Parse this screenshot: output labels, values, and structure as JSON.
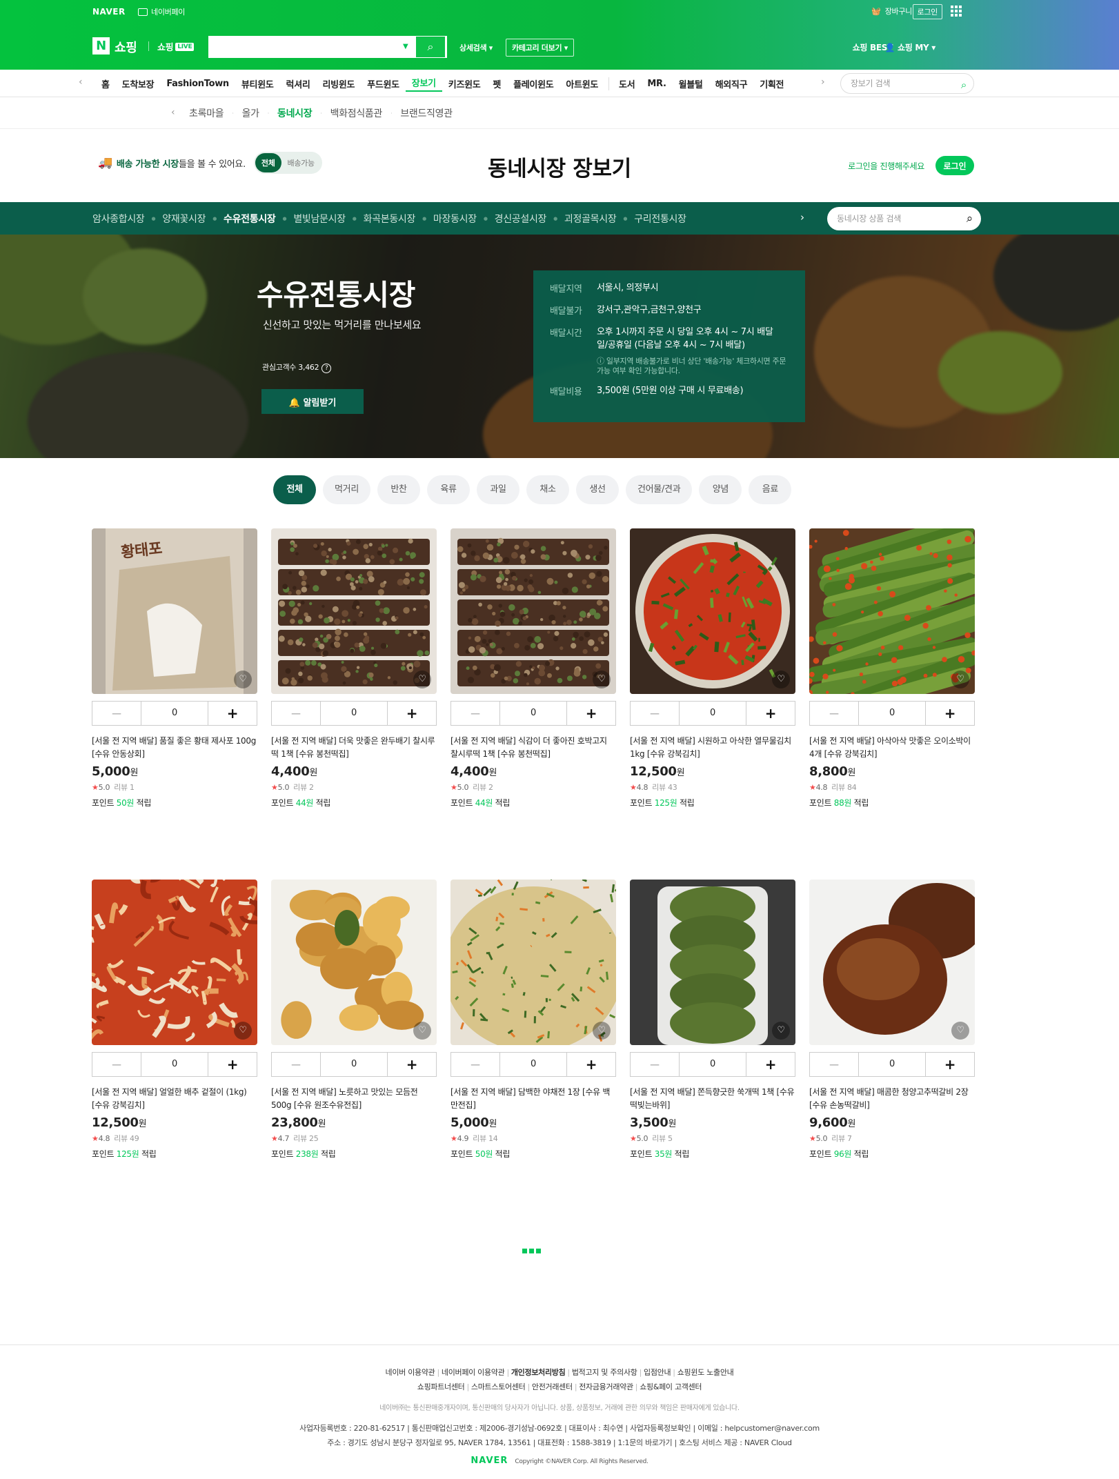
{
  "topbar": {
    "naver": "NAVER",
    "npay": "네이버페이",
    "cart": "장바구니",
    "login": "로그인",
    "shopping": "쇼핑",
    "shoplive": "쇼핑",
    "live": "LIVE",
    "adv_search": "상세검색",
    "cat_more": "카테고리 더보기",
    "best": "쇼핑 BEST",
    "my": "쇼핑 MY"
  },
  "nav": {
    "items": [
      "홈",
      "도착보장",
      "FashionTown",
      "뷰티윈도",
      "럭셔리",
      "리빙윈도",
      "푸드윈도",
      "장보기",
      "키즈윈도",
      "펫",
      "플레이윈도",
      "아트윈도",
      "도서",
      "MR.",
      "윌블털",
      "해외직구",
      "기획전"
    ],
    "active_index": 7,
    "search_placeholder": "장보기 검색"
  },
  "subnav": {
    "items": [
      "초록마을",
      "올가",
      "동네시장",
      "백화점식품관",
      "브랜드직영관"
    ],
    "active_index": 2
  },
  "market_header": {
    "avail_text_bold": "배송 가능한 시장",
    "avail_text": "들을 볼 수 있어요.",
    "toggle_all": "전체",
    "toggle_avail": "배송가능",
    "title": "동네시장 장보기",
    "login_msg": "로그인을 진행해주세요",
    "login_btn": "로그인"
  },
  "market_tabs": {
    "items": [
      "암사종합시장",
      "양재꽃시장",
      "수유전통시장",
      "별빛남문시장",
      "화곡본동시장",
      "마장동시장",
      "경신공설시장",
      "괴정골목시장",
      "구리전통시장"
    ],
    "active_index": 2,
    "search_placeholder": "동네시장 상품 검색"
  },
  "hero": {
    "name": "수유전통시장",
    "subtitle": "신선하고 맛있는 먹거리를 만나보세요",
    "fans": "관심고객수 3,462",
    "alert_btn": "알림받기",
    "info": [
      {
        "k": "배달지역",
        "v": "서울시, 의정부시"
      },
      {
        "k": "배달불가",
        "v": "강서구,관악구,금천구,양천구"
      },
      {
        "k": "배달시간",
        "v": "오후 1시까지 주문 시 당일 오후 4시 ~ 7시 배달\n일/공휴일 (다음날 오후 4시 ~ 7시 배달)"
      },
      {
        "k": "배달비용",
        "v": "3,500원 (5만원 이상 구매 시 무료배송)"
      }
    ],
    "note": "ⓘ 일부지역 배송불가로 비너 상단 '배송가능' 체크하시면 주문 가능 여부 확인 가능합니다."
  },
  "categories": {
    "items": [
      "전체",
      "먹거리",
      "반찬",
      "육류",
      "과일",
      "채소",
      "생선",
      "건어물/견과",
      "양념",
      "음료"
    ],
    "active_index": 0
  },
  "products": [
    {
      "name": "[서울 전 지역 배달] 품질 좋은 황태 제사포 100g [수유 안동상회]",
      "price": "5,000",
      "rating": "5.0",
      "reviews": "리뷰 1",
      "point": "50원",
      "qty": "0",
      "img": "pollack",
      "label": "황태포"
    },
    {
      "name": "[서울 전 지역 배달] 더욱 맛좋은 완두배기 찰시루떡 1책 [수유 봉천떡집]",
      "price": "4,400",
      "rating": "5.0",
      "reviews": "리뷰 2",
      "point": "44원",
      "qty": "0",
      "img": "ricecake"
    },
    {
      "name": "[서울 전 지역 배달] 식감이 더 좋아진 호박고지 찰시루떡 1책 [수유 봉천떡집]",
      "price": "4,400",
      "rating": "5.0",
      "reviews": "리뷰 2",
      "point": "44원",
      "qty": "0",
      "img": "ricecake2"
    },
    {
      "name": "[서울 전 지역 배달] 시원하고 아삭한 열무물김치 1kg [수유 강북김치]",
      "price": "12,500",
      "rating": "4.8",
      "reviews": "리뷰 43",
      "point": "125원",
      "qty": "0",
      "img": "yeolmu"
    },
    {
      "name": "[서울 전 지역 배달] 아삭아삭 맛좋은 오이소박이 4개 [수유 강북김치]",
      "price": "8,800",
      "rating": "4.8",
      "reviews": "리뷰 84",
      "point": "88원",
      "qty": "0",
      "img": "cucumber"
    },
    {
      "name": "[서울 전 지역 배달] 얼얼한 배추 겉절이 (1kg) [수유 강북김치]",
      "price": "12,500",
      "rating": "4.8",
      "reviews": "리뷰 49",
      "point": "125원",
      "qty": "0",
      "img": "kimchi"
    },
    {
      "name": "[서울 전 지역 배달] 노릇하고 맛있는 모듬전 500g [수유 원조수유전집]",
      "price": "23,800",
      "rating": "4.7",
      "reviews": "리뷰 25",
      "point": "238원",
      "qty": "0",
      "img": "jeon"
    },
    {
      "name": "[서울 전 지역 배달] 담백한 야채전 1장 [수유 백만전집]",
      "price": "5,000",
      "rating": "4.9",
      "reviews": "리뷰 14",
      "point": "50원",
      "qty": "0",
      "img": "pajeon"
    },
    {
      "name": "[서울 전 지역 배달] 쫀득향긋한 쑥개떡 1책 [수유 떡빚는바위]",
      "price": "3,500",
      "rating": "5.0",
      "reviews": "리뷰 5",
      "point": "35원",
      "qty": "0",
      "img": "ssuk"
    },
    {
      "name": "[서울 전 지역 배달] 매콤한 청양고추떡갈비 2장 [수유 손농떡갈비]",
      "price": "9,600",
      "rating": "5.0",
      "reviews": "리뷰 7",
      "point": "96원",
      "qty": "0",
      "img": "tteokgalbi"
    }
  ],
  "labels": {
    "won": "원",
    "point_prefix": "포인트 ",
    "point_suffix": " 적립",
    "minus": "−",
    "plus": "+"
  },
  "footer": {
    "row1": [
      "네이버 이용약관",
      "네이버페이 이용약관",
      "개인정보처리방침",
      "법적고지 및 주의사항",
      "입점안내",
      "쇼핑윈도 노출안내"
    ],
    "row2": [
      "쇼핑파트너센터",
      "스마트스토어센터",
      "안전거래센터",
      "전자금융거래약관",
      "쇼핑&페이 고객센터"
    ],
    "disclaimer": "네이버㈜는 통신판매중개자이며, 통신판매의 당사자가 아닙니다. 상품, 상품정보, 거래에 관한 의무와 책임은 판매자에게 있습니다.",
    "info1": "사업자등록번호 : 220-81-62517 | 통신판매업신고번호 : 제2006-경기성남-0692호 | 대표이사 : 최수연 | 사업자등록정보확인 | 이메일 : helpcustomer@naver.com",
    "info2": "주소 : 경기도 성남시 분당구 정자일로 95, NAVER 1784, 13561 | 대표전화 : 1588-3819 | 1:1문의 바로가기 | 호스팅 서비스 제공 : NAVER Cloud",
    "logo": "NAVER",
    "copyright": "Copyright ©NAVER Corp. All Rights Reserved."
  },
  "colors": {
    "brand": "#03c75a",
    "market_dark": "#0b5e4b",
    "star": "#f24c4c"
  }
}
